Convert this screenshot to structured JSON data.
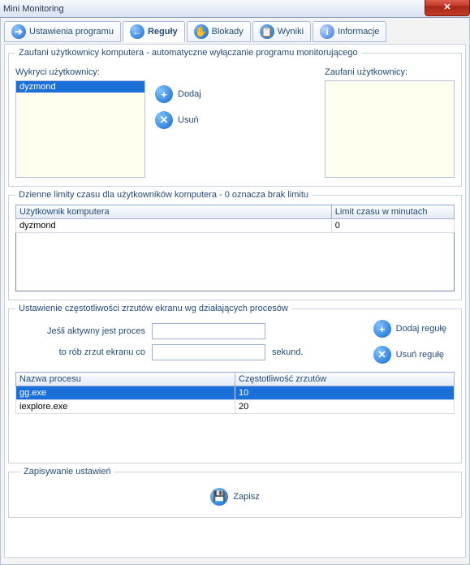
{
  "window": {
    "title": "Mini Monitoring"
  },
  "tabs": {
    "settings": "Ustawienia programu",
    "rules": "Reguły",
    "locks": "Blokady",
    "results": "Wyniki",
    "info": "Informacje"
  },
  "group1": {
    "legend": "Zaufani użytkownicy komputera - automatyczne wyłączanie programu monitorującego",
    "detected_label": "Wykryci użytkownicy:",
    "trusted_label": "Zaufani użytkownicy:",
    "detected_items": [
      "dyzmond"
    ],
    "add": "Dodaj",
    "remove": "Usuń"
  },
  "group2": {
    "legend": "Dzienne limity czasu dla użytkowników komputera - 0 oznacza brak limitu",
    "col_user": "Użytkownik komputera",
    "col_limit": "Limit czasu w minutach",
    "rows": [
      {
        "user": "dyzmond",
        "limit": "0"
      }
    ]
  },
  "group3": {
    "legend": "Ustawienie częstotliwości zrzutów ekranu wg działających procesów",
    "label_if": "Jeśli aktywny jest proces",
    "label_then": "to rób zrzut ekranu co",
    "unit": "sekund.",
    "add_rule": "Dodaj regułę",
    "del_rule": "Usuń regułę",
    "col_proc": "Nazwa procesu",
    "col_freq": "Częstotliwość zrzutów",
    "rows": [
      {
        "proc": "gg.exe",
        "freq": "10"
      },
      {
        "proc": "iexplore.exe",
        "freq": "20"
      }
    ]
  },
  "group4": {
    "legend": "Zapisywanie ustawień",
    "save": "Zapisz"
  },
  "chart_data": null
}
